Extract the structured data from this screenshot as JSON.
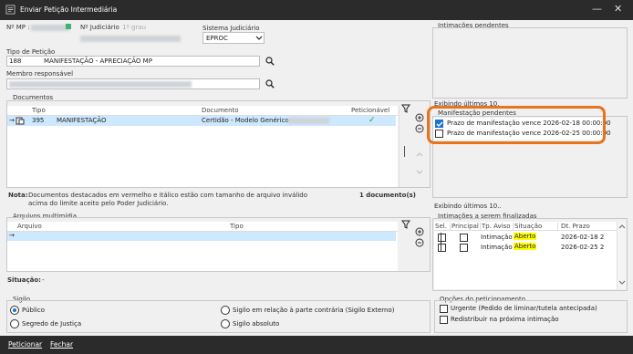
{
  "window": {
    "title": "Enviar Petição Intermediária",
    "minimize": "—",
    "close": "✕"
  },
  "header": {
    "nmp_label": "Nº MP :",
    "njud_label": "Nº Judiciário",
    "grau": "1º grau",
    "sistema_label": "Sistema Judiciário",
    "sistema_value": "EPROC",
    "tipo_label": "Tipo de Petição",
    "tipo_code": "188",
    "tipo_value": "MANIFESTAÇÃO - APRECIAÇÃO MP",
    "membro_label": "Membro responsável"
  },
  "documentos": {
    "section_label": "Documentos",
    "col_tipo": "Tipo",
    "col_documento": "Documento",
    "col_peticionavel": "Peticionável",
    "row": {
      "code": "395",
      "tipo": "MANIFESTAÇÃO",
      "documento": "Certidão - Modelo Genérico",
      "check": "✓"
    },
    "nota_label": "Nota:",
    "nota_text1": "Documentos destacados em vermelho e itálico estão com tamanho de arquivo inválido",
    "nota_text2": "acima do limite aceito pelo Poder Judiciário.",
    "count": "1 documento(s)"
  },
  "arquivos": {
    "section_label": "Arquivos multimídia",
    "col_arquivo": "Arquivo",
    "col_tipo": "Tipo",
    "situacao_label": "Situação:",
    "situacao_value": "-"
  },
  "intimacoes_pendentes": {
    "label": "Intimações pendentes",
    "exibindo": "Exibindo últimos 10."
  },
  "manifestacao": {
    "label": "Manifestação pendentes",
    "items": [
      {
        "text": "Prazo de manifestação vence 2026-02-18 00:00:00",
        "checked": true
      },
      {
        "text": "Prazo de manifestação vence 2026-02-25 00:00:00",
        "checked": false
      }
    ],
    "exibindo": "Exibindo últimos 10.."
  },
  "finalizadas": {
    "label": "Intimações a serem finalizadas",
    "cols": [
      "Sel.",
      "Principal",
      "Tp. Aviso",
      "Situação",
      "Dt. Prazo"
    ],
    "rows": [
      {
        "tp_aviso": "Intimação",
        "situacao": "Aberto",
        "dt_prazo": "2026-02-18 2"
      },
      {
        "tp_aviso": "Intimação",
        "situacao": "Aberto",
        "dt_prazo": "2026-02-25 2"
      }
    ]
  },
  "sigilo": {
    "label": "Sigilo",
    "options": {
      "publico": "Público",
      "segredo": "Segredo de Justiça",
      "parte": "Sigilo em relação à parte contrária (Sigilo Externo)",
      "absoluto": "Sigilo absoluto"
    }
  },
  "opcoes": {
    "label": "Opções do peticionamento",
    "urgente": "Urgente (Pedido de liminar/tutela antecipada)",
    "redistribuir": "Redistribuir na próxima intimação"
  },
  "footer": {
    "peticionar": "Peticionar",
    "fechar": "Fechar"
  },
  "colors": {
    "highlight": "#e8741c",
    "selected_row": "#cde8ff",
    "aberto": "#ffff00",
    "titlebar": "#2b2b2b"
  }
}
